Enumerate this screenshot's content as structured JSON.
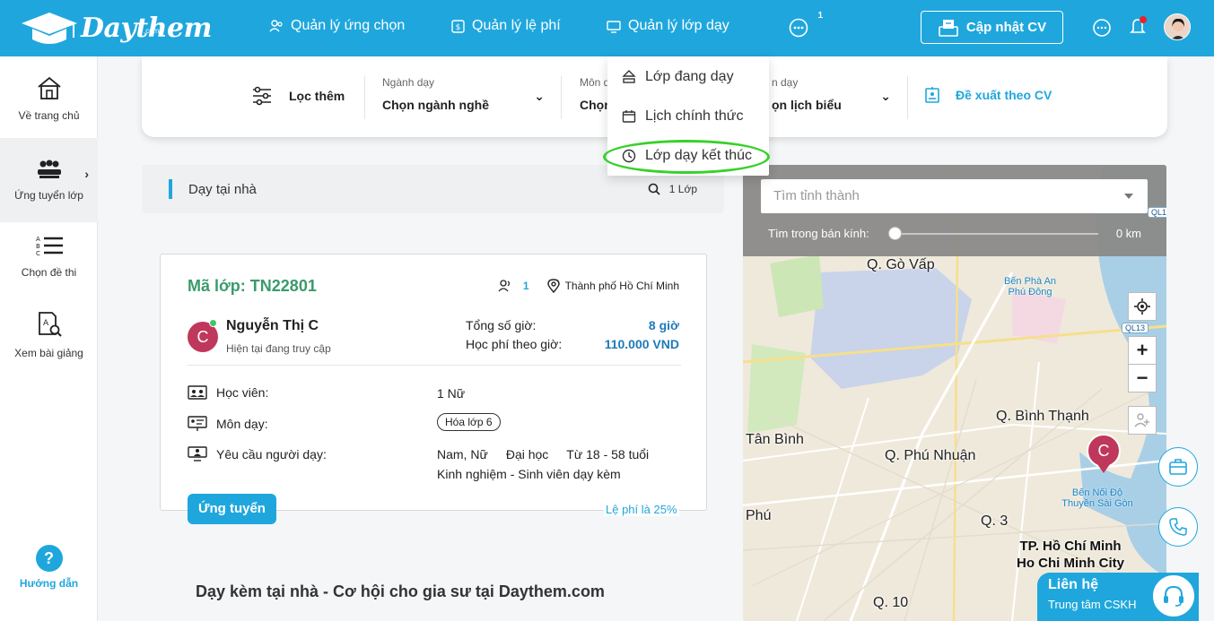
{
  "brand": {
    "name": "Daythem",
    "sub": ".com"
  },
  "nav": {
    "items": [
      {
        "label": "Quản lý ứng chọn"
      },
      {
        "label": "Quản lý lệ phí"
      },
      {
        "label": "Quản lý lớp dạy"
      }
    ],
    "message_badge": "1",
    "cv_button": "Cập nhật CV"
  },
  "dropdown": {
    "items": [
      "Lớp đang dạy",
      "Lịch chính thức",
      "Lớp dạy kết thúc"
    ]
  },
  "sidebar": {
    "items": [
      {
        "label": "Về trang chủ"
      },
      {
        "label": "Ứng tuyển lớp"
      },
      {
        "label": "Chọn đề thi"
      },
      {
        "label": "Xem bài giảng"
      }
    ],
    "help": "Hướng dẫn"
  },
  "filter": {
    "more": "Lọc thêm",
    "major_caption": "Ngành dạy",
    "major_value": "Chọn ngành nghề",
    "subject_caption": "Môn d",
    "subject_value": "Chọn",
    "schedule_caption": "n dạy",
    "schedule_value": "ọn lịch biểu",
    "suggest": "Đề xuất theo CV"
  },
  "section": {
    "title": "Dạy tại nhà",
    "count": "1 Lớp"
  },
  "card": {
    "code": "Mã lớp: TN22801",
    "student_count": "1",
    "city": "Thành phố Hồ Chí Minh",
    "avatar_letter": "C",
    "teacher_name": "Nguyễn Thị C",
    "teacher_status": "Hiện tại đang truy cập",
    "hours_label": "Tổng số giờ:",
    "hours_value": "8 giờ",
    "fee_label": "Học phí theo giờ:",
    "fee_value": "110.000 VND",
    "students_label": "Học viên:",
    "students_value": "1 Nữ",
    "subject_label": "Môn dạy:",
    "subject_value": "Hóa lớp 6",
    "req_label": "Yêu cầu người dạy:",
    "req_gender": "Nam, Nữ",
    "req_level": "Đại học",
    "req_age": "Từ 18 - 58 tuổi",
    "req_exp": "Kinh nghiệm - Sinh viên dạy kèm",
    "apply": "Ứng tuyển",
    "fee_note": "Lệ phí là 25%"
  },
  "bottom_title": "Dạy kèm tại nhà - Cơ hội cho gia sư tại Daythem.com",
  "map": {
    "search_placeholder": "Tìm tỉnh thành",
    "radius_label": "Tìm trong bán kính:",
    "radius_value": "0 km",
    "radius_fraction": 0,
    "labels": [
      "Q. Gò Vấp",
      "Q. Bình Thạnh",
      "Tân Bình",
      "Q. Phú Nhuận",
      "Phú",
      "Q. 3",
      "Q. 10"
    ],
    "poi": [
      "Bến Phà An Phú Đông",
      "Bến Nối Độ Thuyền Sài Gòn"
    ],
    "city": [
      "TP. Hồ Chí Minh",
      "Ho Chi Minh City"
    ],
    "roads": [
      "QL1",
      "QL13"
    ],
    "pin_letter": "C"
  },
  "contact": {
    "title": "Liên hệ",
    "sub": "Trung tâm CSKH"
  },
  "colors": {
    "primary": "#1fa7dd",
    "code_green": "#3a9b6b",
    "avatar": "#c0375c",
    "highlight": "#37d12a"
  }
}
